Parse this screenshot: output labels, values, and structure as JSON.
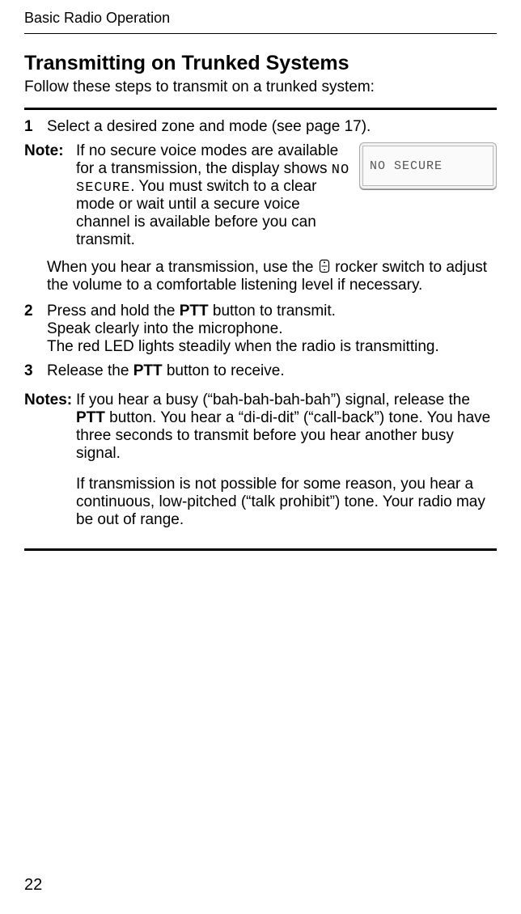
{
  "header": "Basic Radio Operation",
  "title": "Transmitting on Trunked Systems",
  "intro": "Follow these steps to transmit on a trunked system:",
  "steps": {
    "s1": {
      "num": "1",
      "text": "Select a desired zone and mode (see page 17)."
    },
    "s2": {
      "num": "2",
      "line1": "Press and hold the ",
      "ptt": "PTT",
      "line1b": " button to transmit.",
      "line2": "Speak clearly into the microphone.",
      "line3": "The red LED lights steadily when the radio is transmitting."
    },
    "s3": {
      "num": "3",
      "a": "Release the ",
      "ptt": "PTT",
      "b": " button to receive."
    }
  },
  "note": {
    "label": "Note:",
    "a": "If no secure voice modes are available for a transmission, the display shows ",
    "mono": "NO SECURE",
    "b": ". You must switch to a clear mode or wait until a secure voice channel is available before you can transmit."
  },
  "display_text": "NO SECURE",
  "volume": {
    "a": "When you hear a transmission, use the ",
    "b": " rocker switch to adjust the volume to a comfortable listening level if necessary."
  },
  "notes": {
    "label": "Notes:",
    "p1a": "If you hear a busy (“bah-bah-bah-bah”) signal, release the ",
    "ptt": "PTT",
    "p1b": " button. You hear a “di-di-dit” (“call-back”) tone. You have three seconds to transmit before you hear another busy signal.",
    "p2": "If transmission is not possible for some reason, you hear a continuous, low-pitched (“talk prohibit”) tone. Your radio may be out of range."
  },
  "page_number": "22"
}
